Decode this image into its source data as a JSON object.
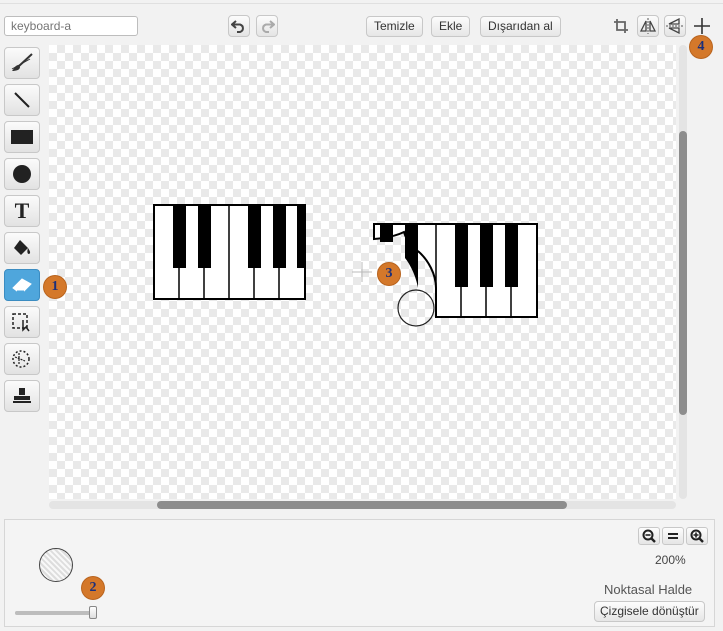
{
  "costume_name": {
    "value": "",
    "placeholder": "keyboard-a"
  },
  "toolbar_top": {
    "undo_icon": "undo-icon",
    "redo_icon": "redo-icon",
    "clear_label": "Temizle",
    "add_label": "Ekle",
    "import_label": "Dışarıdan al",
    "crop_icon": "crop-icon",
    "flip_horizontal_icon": "flip-horizontal-icon",
    "flip_vertical_icon": "flip-vertical-icon",
    "set_center_icon": "crosshair-icon"
  },
  "tools": [
    {
      "name": "brush-tool",
      "icon": "brush-icon",
      "active": false
    },
    {
      "name": "line-tool",
      "icon": "line-icon",
      "active": false
    },
    {
      "name": "rectangle-tool",
      "icon": "rectangle-icon",
      "active": false
    },
    {
      "name": "ellipse-tool",
      "icon": "ellipse-icon",
      "active": false
    },
    {
      "name": "text-tool",
      "icon": "text-icon",
      "glyph": "T",
      "active": false
    },
    {
      "name": "fill-tool",
      "icon": "paint-bucket-icon",
      "active": false
    },
    {
      "name": "eraser-tool",
      "icon": "eraser-icon",
      "active": true
    },
    {
      "name": "select-tool",
      "icon": "select-icon",
      "active": false
    },
    {
      "name": "magic-select-tool",
      "icon": "magic-wand-select-icon",
      "active": false
    },
    {
      "name": "stamp-tool",
      "icon": "stamp-icon",
      "active": false
    }
  ],
  "brush_size": {
    "fraction": 1.0
  },
  "zoom": {
    "value": "200%"
  },
  "mode_label": "Noktasal Halde",
  "convert_button": "Çizgisele dönüştür",
  "markers": [
    "1",
    "2",
    "3",
    "4"
  ],
  "colors": {
    "active_tool": "#4fa6dc",
    "marker": "#d4782a",
    "marker_text": "#1b2f7a"
  }
}
